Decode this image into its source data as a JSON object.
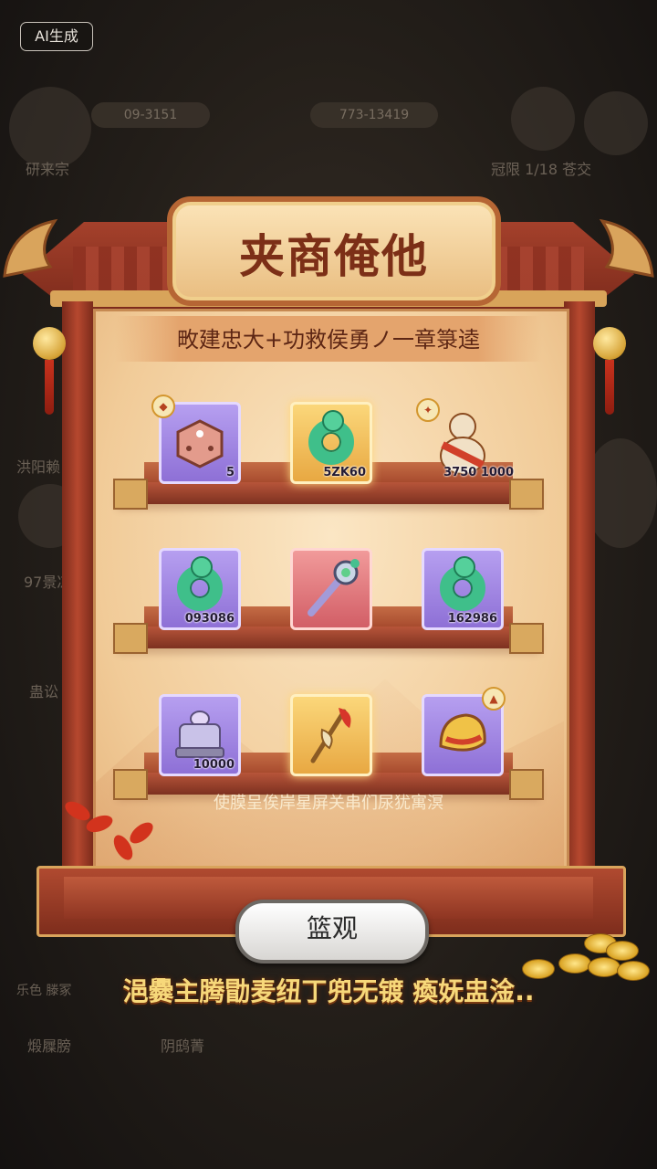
{
  "badge": {
    "label": "AI生成"
  },
  "title": "夹商俺他",
  "subtitle": "畋建忠大+功救侯勇ノ一章箓逵",
  "shelves": [
    {
      "items": [
        {
          "rarity": "purple",
          "icon": "dice-icon",
          "label": "5",
          "badge": "coin-badge-icon"
        },
        {
          "rarity": "gold",
          "icon": "jade-ring-icon",
          "label": "5ZK60",
          "badge": ""
        },
        {
          "rarity": "none",
          "icon": "gourd-icon",
          "label": "3750   1000",
          "badge": "spark-badge-icon"
        }
      ]
    },
    {
      "items": [
        {
          "rarity": "purple",
          "icon": "jade-ring-icon",
          "label": "093086",
          "badge": ""
        },
        {
          "rarity": "red",
          "icon": "scepter-icon",
          "label": "",
          "badge": ""
        },
        {
          "rarity": "purple",
          "icon": "jade-ring-icon",
          "label": "162986",
          "badge": ""
        }
      ]
    },
    {
      "items": [
        {
          "rarity": "purple",
          "icon": "anvil-icon",
          "label": "10000",
          "badge": ""
        },
        {
          "rarity": "gold",
          "icon": "feather-icon",
          "label": "",
          "badge": ""
        },
        {
          "rarity": "purple",
          "icon": "helmet-icon",
          "label": "",
          "badge": "fire-badge-icon"
        }
      ]
    }
  ],
  "footer_note": "使膜呈俟岸星屏关串们尿犹寓溟",
  "confirm_label": "篮观",
  "hint": "浥爨主腾勖麦纽丁兜无镀 瘓妩盅淦..",
  "background": {
    "labels": [
      "09-3151",
      "773-13419",
      "研来宗",
      "冠限 1/18 苍交",
      "洪阳赖",
      "97景凉",
      "蛊讼",
      "乐色 滕冢",
      "煅屧膀",
      "阴鸱菁"
    ]
  },
  "colors": {
    "frame": "#a9432d",
    "gold": "#d8a45a",
    "panel": "#f1cb98",
    "hint": "#f7d87a"
  }
}
